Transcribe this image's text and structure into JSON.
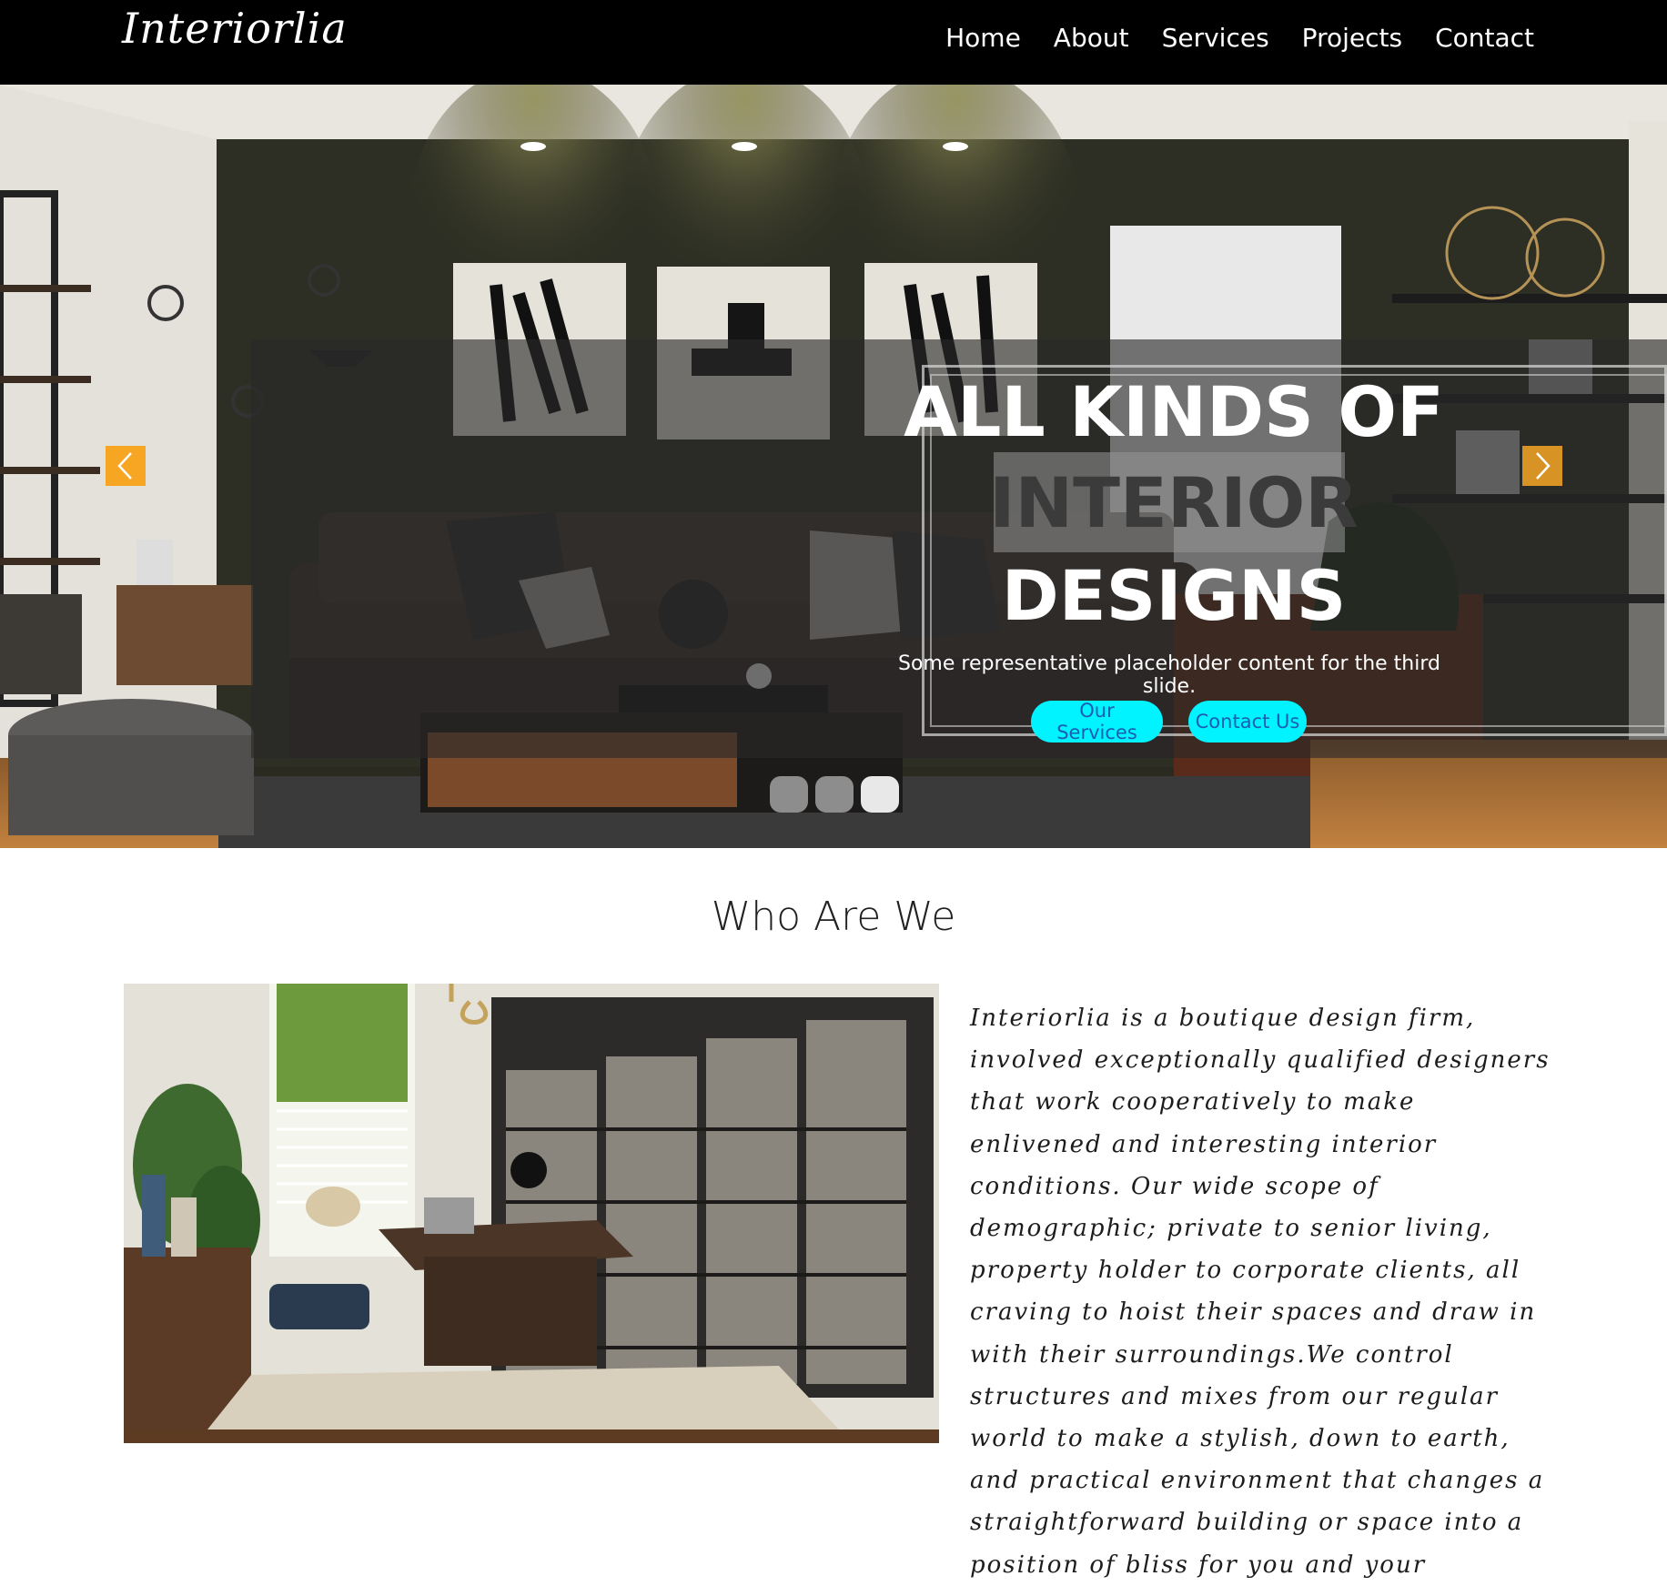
{
  "brand": {
    "name": "Interiorlia"
  },
  "nav": {
    "items": [
      {
        "label": "Home"
      },
      {
        "label": "About"
      },
      {
        "label": "Services"
      },
      {
        "label": "Projects"
      },
      {
        "label": "Contact"
      }
    ]
  },
  "hero": {
    "title_line1": "ALL KINDS OF",
    "title_line2": "INTERIOR",
    "title_line3": "DESIGNS",
    "subtitle": "Some representative placeholder content for the third slide.",
    "primary_button": "Our Services",
    "secondary_button": "Contact Us",
    "slide_count": 3,
    "active_slide": 3,
    "arrow_color": "#f6a623",
    "button_color": "#00f3ff"
  },
  "about": {
    "title": "Who Are We",
    "text": "Interiorlia is a boutique design firm, involved exceptionally qualified designers that work cooperatively to make enlivened and interesting interior conditions. Our wide scope of demographic; private to senior living, property holder to corporate clients, all craving to hoist their spaces and draw in with their surroundings.We control structures and mixes from our regular world to make a stylish, down to earth, and practical environment that changes a straightforward building or space into a position of bliss for you and your"
  }
}
